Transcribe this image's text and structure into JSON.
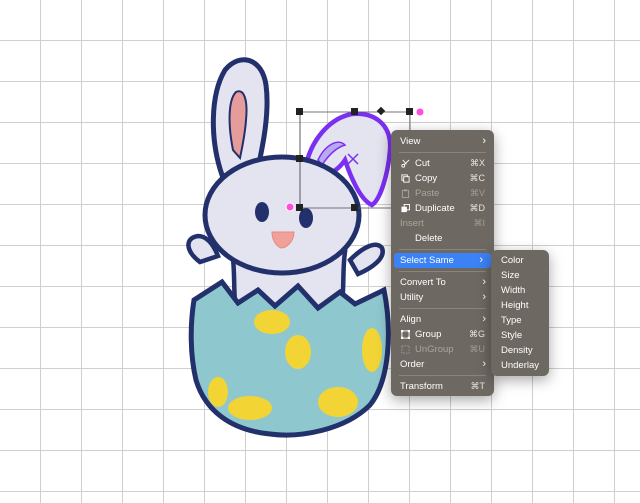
{
  "context_menu": {
    "items": [
      {
        "label": "View",
        "submenu": true
      },
      {
        "label": "Cut",
        "shortcut": "⌘X",
        "icon": "scissors-icon"
      },
      {
        "label": "Copy",
        "shortcut": "⌘C",
        "icon": "copy-icon"
      },
      {
        "label": "Paste",
        "shortcut": "⌘V",
        "icon": "paste-icon",
        "disabled": true
      },
      {
        "label": "Duplicate",
        "shortcut": "⌘D",
        "icon": "duplicate-icon"
      },
      {
        "label": "Insert",
        "shortcut": "⌘I",
        "disabled": true
      },
      {
        "label": "Delete"
      },
      {
        "label": "Select Same",
        "submenu": true,
        "active": true
      },
      {
        "label": "Convert To",
        "submenu": true
      },
      {
        "label": "Utility",
        "submenu": true
      },
      {
        "label": "Align",
        "submenu": true
      },
      {
        "label": "Group",
        "shortcut": "⌘G",
        "icon": "group-icon"
      },
      {
        "label": "UnGroup",
        "shortcut": "⌘U",
        "icon": "ungroup-icon",
        "disabled": true
      },
      {
        "label": "Order",
        "submenu": true
      },
      {
        "label": "Transform",
        "shortcut": "⌘T"
      }
    ],
    "submenu_arrow": "›"
  },
  "select_same_submenu": {
    "items": [
      "Color",
      "Size",
      "Width",
      "Height",
      "Type",
      "Style",
      "Density",
      "Underlay"
    ]
  },
  "colors": {
    "menu_bg": "#6d6862",
    "highlight": "#3b82f6",
    "outline": "#22306b",
    "bunny_fill": "#e4e3f0",
    "egg_fill": "#8fc7cf",
    "dots": "#f2d534",
    "ear_pink": "#e79c9c",
    "selected_ear": "#7b2ff0"
  }
}
